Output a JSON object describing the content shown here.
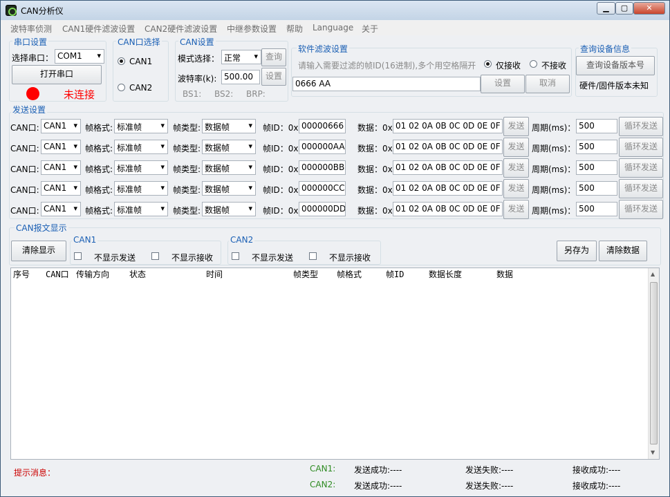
{
  "window": {
    "title": "CAN分析仪",
    "minimize": "▁",
    "maximize": "▢",
    "close": "✕"
  },
  "menu": [
    "波特率侦测",
    "CAN1硬件滤波设置",
    "CAN2硬件滤波设置",
    "中继参数设置",
    "帮助",
    "Language",
    "关于"
  ],
  "serial": {
    "title": "串口设置",
    "port_label": "选择串口：",
    "port_value": "COM1",
    "open_button": "打开串口",
    "status": "未连接",
    "status_color": "#ff0000"
  },
  "can_select": {
    "title": "CAN口选择",
    "options": [
      "CAN1",
      "CAN2"
    ],
    "selected": "CAN1"
  },
  "can_settings": {
    "title": "CAN设置",
    "mode_label": "模式选择：",
    "mode_value": "正常",
    "query_button": "查询",
    "baud_label": "波特率(k):",
    "baud_value": "500.00",
    "set_button": "设置",
    "bs1": "BS1:",
    "bs2": "BS2:",
    "brp": "BRP:"
  },
  "soft_filter": {
    "title": "软件滤波设置",
    "placeholder": "请输入需要过滤的帧ID(16进制),多个用空格隔开",
    "only_receive": "仅接收",
    "not_receive": "不接收",
    "filter_value": "0666 AA",
    "set_button": "设置",
    "cancel_button": "取消"
  },
  "device_info": {
    "title": "查询设备信息",
    "query_button": "查询设备版本号",
    "version_text": "硬件/固件版本未知"
  },
  "send": {
    "title": "发送设置",
    "can_label": "CAN口:",
    "format_label": "帧格式:",
    "type_label": "帧类型:",
    "id_label": "帧ID：0x",
    "data_label": "数据：0x",
    "send_button": "发送",
    "period_label": "周期(ms)：",
    "loop_button": "循环发送",
    "rows": [
      {
        "can": "CAN1",
        "format": "标准帧",
        "type": "数据帧",
        "id": "00000666",
        "data": "01 02 0A 0B 0C 0D 0E 0F",
        "period": "500"
      },
      {
        "can": "CAN1",
        "format": "标准帧",
        "type": "数据帧",
        "id": "000000AA",
        "data": "01 02 0A 0B 0C 0D 0E 0F",
        "period": "500"
      },
      {
        "can": "CAN1",
        "format": "标准帧",
        "type": "数据帧",
        "id": "000000BB",
        "data": "01 02 0A 0B 0C 0D 0E 0F",
        "period": "500"
      },
      {
        "can": "CAN1",
        "format": "标准帧",
        "type": "数据帧",
        "id": "000000CC",
        "data": "01 02 0A 0B 0C 0D 0E 0F",
        "period": "500"
      },
      {
        "can": "CAN1",
        "format": "标准帧",
        "type": "数据帧",
        "id": "000000DD",
        "data": "01 02 0A 0B 0C 0D 0E 0F",
        "period": "500"
      }
    ]
  },
  "display": {
    "title": "CAN报文显示",
    "clear_button": "清除显示",
    "can1_title": "CAN1",
    "can2_title": "CAN2",
    "hide_send": "不显示发送",
    "hide_receive": "不显示接收",
    "save_as_button": "另存为",
    "clear_data_button": "清除数据",
    "columns": [
      "序号",
      "CAN口",
      "传输方向",
      "状态",
      "时间",
      "帧类型",
      "帧格式",
      "帧ID",
      "数据长度",
      "数据"
    ]
  },
  "status_bar": {
    "hint_label": "提示消息：",
    "can1": "CAN1:",
    "can2": "CAN2:",
    "send_ok": "发送成功:----",
    "send_fail": "发送失败:----",
    "recv_ok": "接收成功:----"
  }
}
